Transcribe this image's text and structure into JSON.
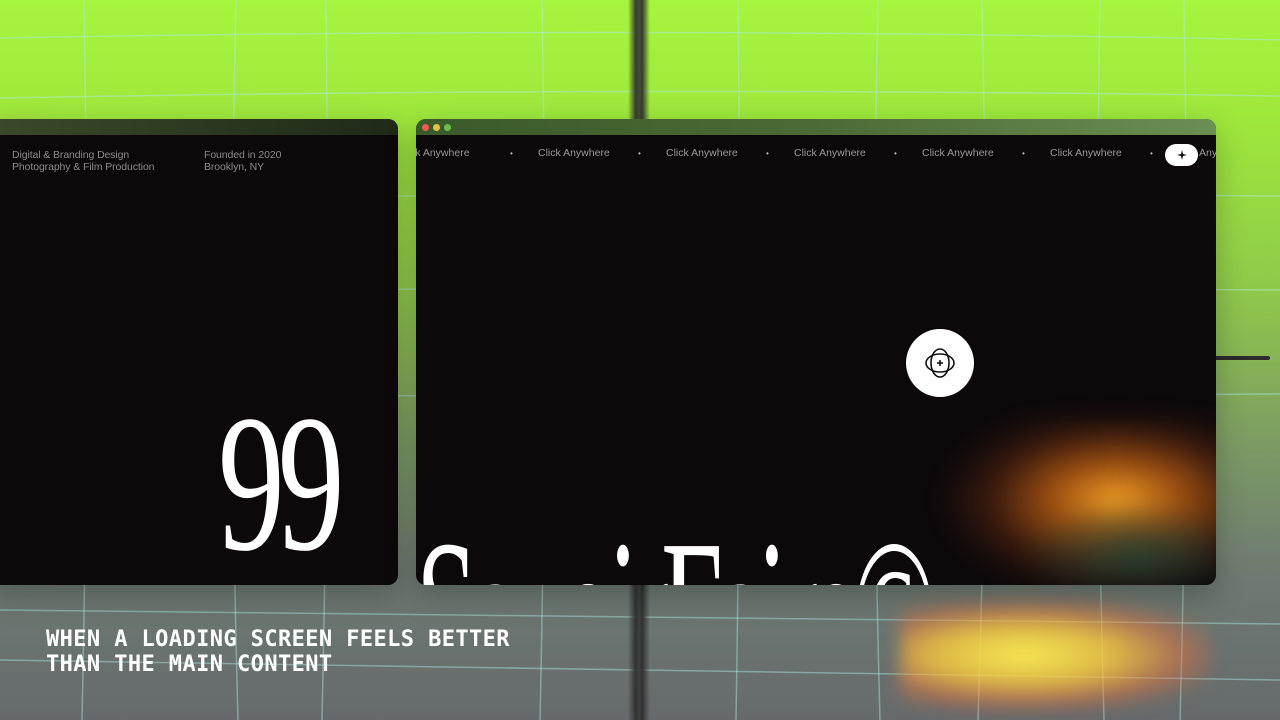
{
  "left_window": {
    "meta_col1": [
      "Digital & Branding Design",
      "Photography & Film Production"
    ],
    "meta_col2": [
      "Founded in 2020",
      "Brooklyn, NY"
    ],
    "big_number": "99"
  },
  "right_window": {
    "window_controls": [
      "close",
      "minimize",
      "maximize"
    ],
    "ticker_label": "Click Anywhere",
    "ticker_items": [
      "ck Anywhere",
      "Click Anywhere",
      "Click Anywhere",
      "Click Anywhere",
      "Click Anywhere",
      "Click Anywhere"
    ],
    "ticker_tail": "Any",
    "pill_icon": "sparkle-icon",
    "center_icon": "orbit-globe-icon",
    "brand": "SavoirFaire©"
  },
  "caption": [
    "WHEN A LOADING SCREEN FEELS BETTER",
    "THAN THE MAIN CONTENT"
  ],
  "colors": {
    "accent_green": "#a6f53e",
    "window_bg": "#0d090b",
    "dot_red": "#ee5b4f",
    "dot_yellow": "#e5c14a",
    "dot_green": "#6cc04a"
  }
}
